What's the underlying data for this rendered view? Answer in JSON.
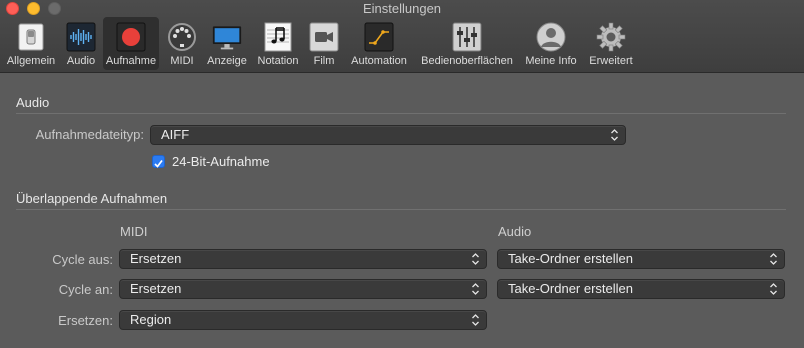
{
  "window": {
    "title": "Einstellungen"
  },
  "toolbar": {
    "items": [
      {
        "label": "Allgemein",
        "icon": "switch-icon"
      },
      {
        "label": "Audio",
        "icon": "waveform-icon"
      },
      {
        "label": "Aufnahme",
        "icon": "record-icon",
        "selected": true
      },
      {
        "label": "MIDI",
        "icon": "midi-port-icon"
      },
      {
        "label": "Anzeige",
        "icon": "display-icon"
      },
      {
        "label": "Notation",
        "icon": "notation-icon"
      },
      {
        "label": "Film",
        "icon": "film-camera-icon"
      },
      {
        "label": "Automation",
        "icon": "automation-icon"
      },
      {
        "label": "Bedienoberflächen",
        "icon": "control-surface-icon"
      },
      {
        "label": "Meine Info",
        "icon": "user-icon"
      },
      {
        "label": "Erweitert",
        "icon": "gear-icon"
      }
    ]
  },
  "audio_section": {
    "title": "Audio",
    "filetype_label": "Aufnahmedateityp:",
    "filetype_value": "AIFF",
    "bit24_label": "24-Bit-Aufnahme",
    "bit24_checked": true
  },
  "overlap_section": {
    "title": "Überlappende Aufnahmen",
    "col_midi": "MIDI",
    "col_audio": "Audio",
    "rows": [
      {
        "label": "Cycle aus:",
        "midi": "Ersetzen",
        "audio": "Take-Ordner erstellen"
      },
      {
        "label": "Cycle an:",
        "midi": "Ersetzen",
        "audio": "Take-Ordner erstellen"
      },
      {
        "label": "Ersetzen:",
        "midi": "Region"
      }
    ]
  },
  "colors": {
    "accent": "#2b7bf2",
    "record": "#e8403a",
    "window_bg": "#5b5b5b"
  }
}
